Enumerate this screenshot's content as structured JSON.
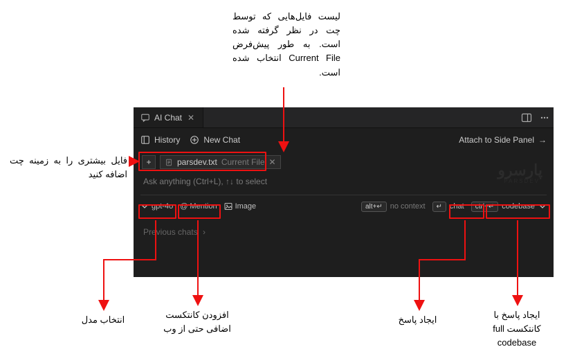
{
  "titlebar": {
    "tab_label": "AI Chat",
    "close_glyph": "✕"
  },
  "subbar": {
    "history": "History",
    "new_chat": "New Chat",
    "attach": "Attach to Side Panel",
    "arrow_glyph": "→"
  },
  "chipbar": {
    "plus_glyph": "+",
    "file_name": "parsdev.txt",
    "file_tag": "Current File",
    "chip_close_glyph": "✕"
  },
  "ask": {
    "placeholder": "Ask anything (Ctrl+L), ↑↓ to select"
  },
  "toolbar": {
    "model": "gpt-4o",
    "mention": "@ Mention",
    "image": "Image",
    "nocontext_kbd": "alt+↵",
    "nocontext_label": "no context",
    "chat_kbd": "↵",
    "chat_label": "chat",
    "codebase_kbd": "ctrl+↵",
    "codebase_label": "codebase"
  },
  "prev": {
    "label": "Previous chats",
    "chev": "›"
  },
  "watermark": {
    "main": "پارسرو",
    "sub": "PARSDEV"
  },
  "callouts": {
    "top": "لیست فایل‌هایی که توسط چت در نظر گرفته شده است. به طور پیش‌فرض Current File انتخاب شده است.",
    "left": "فایل بیشتری را به زمینه چت اضافه کنید",
    "model": "انتخاب مدل",
    "mention": "افزودن کانتکست اضافی حتی از وب",
    "chat": "ایجاد پاسخ",
    "codebase": "ایجاد پاسخ با کانتکست full codebase"
  }
}
